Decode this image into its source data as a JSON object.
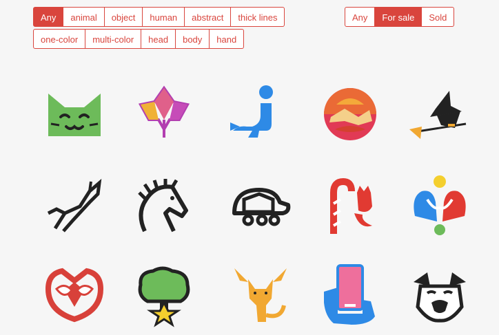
{
  "filters": {
    "row1": [
      "Any",
      "animal",
      "object",
      "human",
      "abstract",
      "thick lines"
    ],
    "row2": [
      "one-color",
      "multi-color",
      "head",
      "body",
      "hand"
    ],
    "active": "Any"
  },
  "sale_filter": {
    "options": [
      "Any",
      "For sale",
      "Sold"
    ],
    "active": "For sale"
  },
  "icons": [
    "cat-face-icon",
    "maple-leaf-icon",
    "seal-with-ball-icon",
    "sunset-circle-icon",
    "witch-on-broom-icon",
    "leaping-deer-icon",
    "horse-head-icon",
    "turtle-icon",
    "candy-cane-cat-icon",
    "colorful-hands-icon",
    "owl-face-icon",
    "tree-with-star-icon",
    "winged-cat-icon",
    "hand-holding-phone-icon",
    "pug-face-icon"
  ],
  "colors": {
    "accent": "#d9453d",
    "background": "#f6f6f6"
  }
}
